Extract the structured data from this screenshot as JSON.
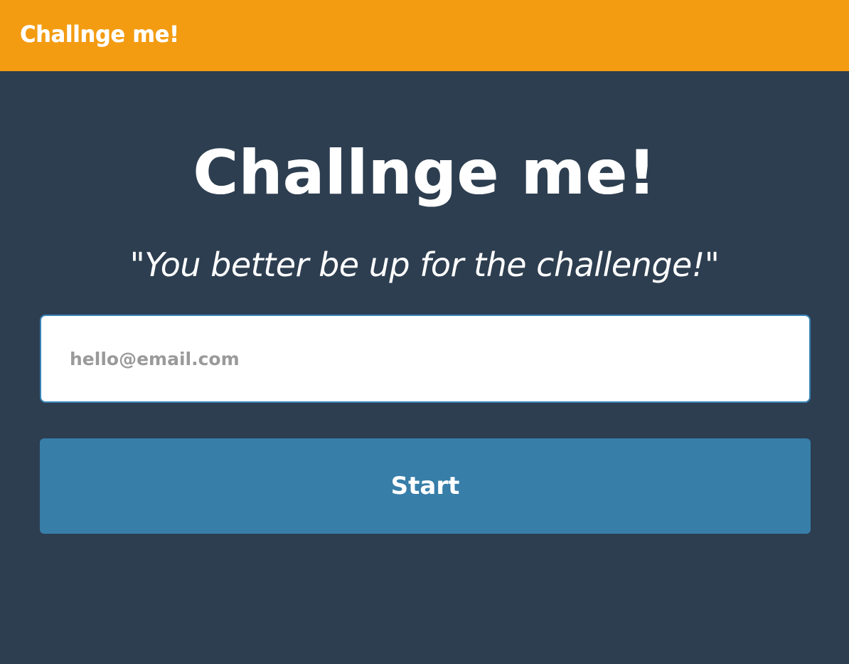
{
  "navbar": {
    "brand": "Challnge me!"
  },
  "hero": {
    "title": "Challnge me!",
    "tagline": "\"You better be up for the challenge!\""
  },
  "form": {
    "email_value": "",
    "email_placeholder": "hello@email.com",
    "start_label": "Start"
  },
  "colors": {
    "navbar_bg": "#f39c12",
    "page_bg": "#2d3e50",
    "button_bg": "#377ea9",
    "input_border": "#3b86b8"
  }
}
